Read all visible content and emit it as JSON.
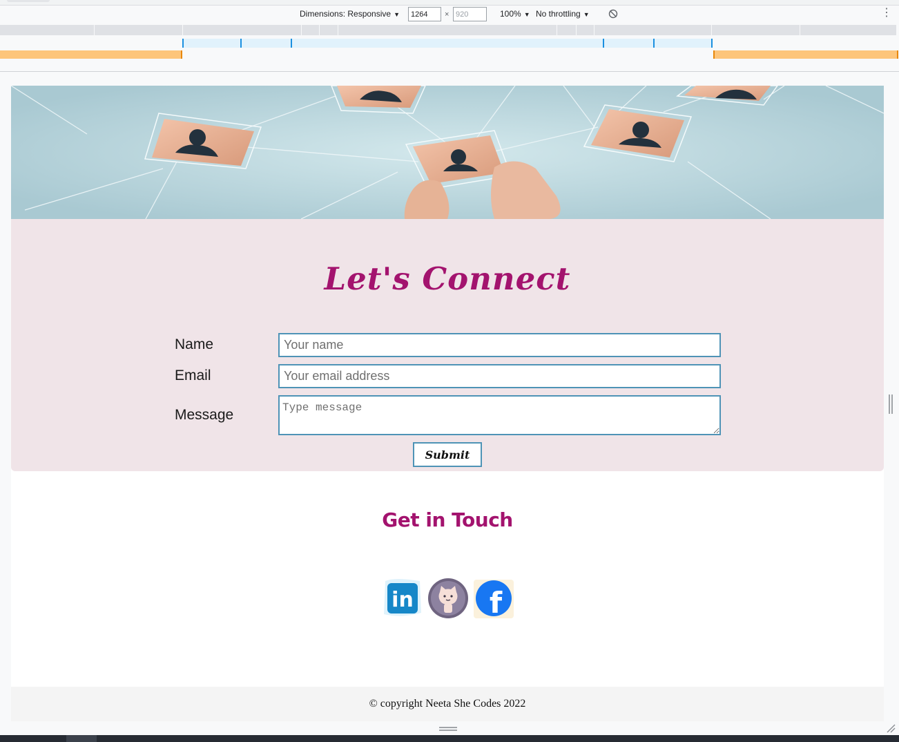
{
  "devtools": {
    "dimensions_label": "Dimensions: Responsive",
    "width_value": "1264",
    "times_sign": "×",
    "height_value": "920",
    "zoom": "100%",
    "throttling": "No throttling",
    "caret": "▼",
    "rotate_icon": "rotate-icon",
    "menu_icon": "more-vert-icon",
    "kebab": "⋮"
  },
  "page": {
    "hero_icon": "connected-people-network-image",
    "title": "Let's Connect",
    "form": {
      "name_label": "Name",
      "name_placeholder": "Your name",
      "email_label": "Email",
      "email_placeholder": "Your email address",
      "message_label": "Message",
      "message_placeholder": "Type message",
      "submit_label": "Submit"
    },
    "touch_title": "Get in Touch",
    "social": [
      {
        "icon": "linkedin-icon",
        "label": "in"
      },
      {
        "icon": "github-icon"
      },
      {
        "icon": "facebook-icon",
        "label": "f"
      }
    ],
    "footer": "© copyright Neeta She Codes 2022"
  },
  "colors": {
    "accent": "#a3136e",
    "form_background": "#f0e4e8",
    "field_border": "#4e93b6",
    "ruler_orange": "#fdc57a",
    "ruler_blue": "#e1f2fc"
  }
}
